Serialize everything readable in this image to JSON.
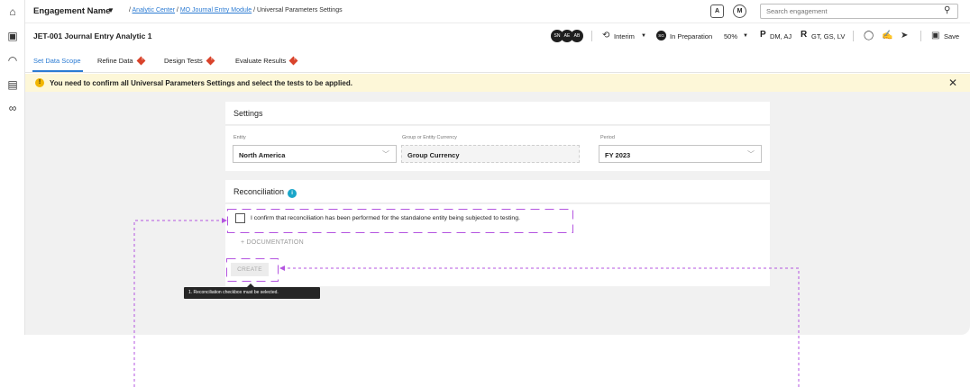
{
  "header": {
    "engagement_name": "Engagement Name",
    "breadcrumb_sep1": " / ",
    "breadcrumb_analytic_center": "Analytic Center",
    "breadcrumb_sep2": " / ",
    "breadcrumb_module": "MO Journal Entry Module",
    "breadcrumb_sep3": " / ",
    "breadcrumb_current": "Universal Parameters Settings",
    "badge_a": "A",
    "badge_m": "M",
    "search_placeholder": "Search engagement"
  },
  "subheader": {
    "title": "JET-001 Journal Entry Analytic 1",
    "avatars": [
      "SN",
      "AE",
      "AB"
    ],
    "phase": "Interim",
    "status_initials": "SG",
    "status": "In Preparation",
    "progress": "50%",
    "preparer_letter": "P",
    "preparers": "DM, AJ",
    "reviewer_letter": "R",
    "reviewers": "GT, GS, LV",
    "save_label": "Save"
  },
  "tabs": [
    {
      "label": "Set Data Scope",
      "active": true,
      "warning": false
    },
    {
      "label": "Refine Data",
      "active": false,
      "warning": true
    },
    {
      "label": "Design Tests",
      "active": false,
      "warning": true
    },
    {
      "label": "Evaluate Results",
      "active": false,
      "warning": true
    }
  ],
  "banner": {
    "message": "You need to confirm all Universal Parameters Settings and select the tests to be applied."
  },
  "settings": {
    "title": "Settings",
    "entity_label": "Entity",
    "entity_value": "North America",
    "currency_label": "Group or Entity Currency",
    "currency_value": "Group Currency",
    "period_label": "Period",
    "period_value": "FY 2023"
  },
  "reconciliation": {
    "title": "Reconciliation",
    "checkbox_label": "I confirm that reconciliation has been performed for the standalone entity being subjected to testing.",
    "documentation_label": "DOCUMENTATION",
    "create_label": "CREATE",
    "tooltip": "1. Reconciliation checkbox must be selected."
  },
  "colors": {
    "accent": "#2b7bd3",
    "warning_banner": "#fdf7d8",
    "warning_icon": "#f2b600",
    "tab_alert": "#d9432b",
    "annotation": "#b455e0"
  }
}
